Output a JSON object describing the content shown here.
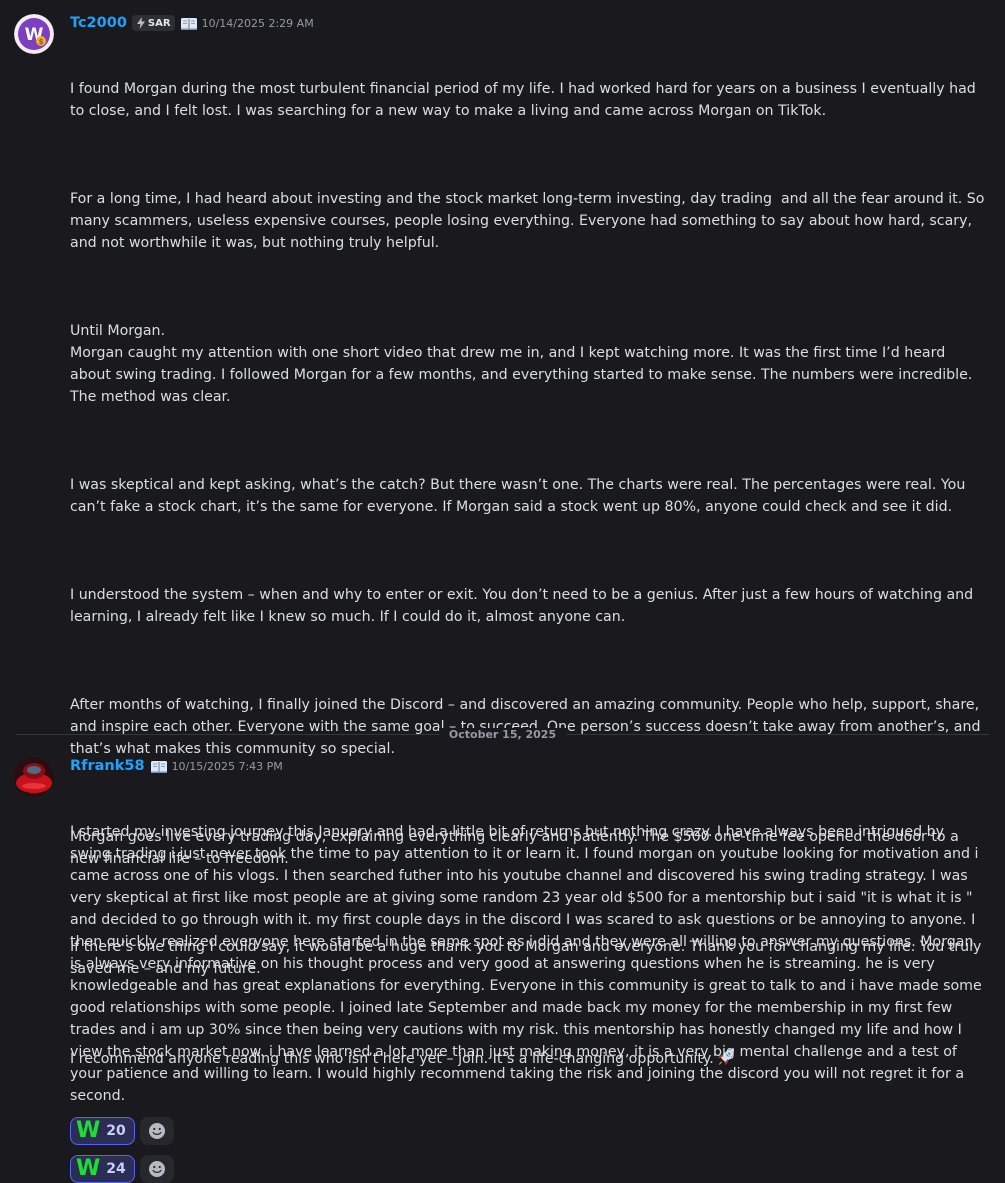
{
  "messages": [
    {
      "username": "Tc2000",
      "tag": "SAR",
      "tag_icon": "lightning-icon",
      "badge_icon": "book-icon",
      "timestamp": "10/14/2025 2:29 AM",
      "paragraphs": [
        "I found Morgan during the most turbulent financial period of my life. I had worked hard for years on a business I eventually had to close, and I felt lost. I was searching for a new way to make a living and came across Morgan on TikTok.",
        "For a long time, I had heard about investing and the stock market long-term investing, day trading  and all the fear around it. So many scammers, useless expensive courses, people losing everything. Everyone had something to say about how hard, scary, and not worthwhile it was, but nothing truly helpful.",
        "Until Morgan.\nMorgan caught my attention with one short video that drew me in, and I kept watching more. It was the first time I’d heard about swing trading. I followed Morgan for a few months, and everything started to make sense. The numbers were incredible. The method was clear.",
        "I was skeptical and kept asking, what’s the catch? But there wasn’t one. The charts were real. The percentages were real. You can’t fake a stock chart, it’s the same for everyone. If Morgan said a stock went up 80%, anyone could check and see it did.",
        "I understood the system – when and why to enter or exit. You don’t need to be a genius. After just a few hours of watching and learning, I already felt like I knew so much. If I could do it, almost anyone can.",
        "After months of watching, I finally joined the Discord – and discovered an amazing community. People who help, support, share, and inspire each other. Everyone with the same goal – to succeed. One person’s success doesn’t take away from another’s, and that’s what makes this community so special.",
        "Morgan goes live every trading day, explaining everything clearly and patiently. The $500 one-time fee opened the door to a new financial life – to freedom.",
        "If there’s one thing I could say, it would be a huge thank you to Morgan and everyone. Thank you for changing my life. You truly saved me – and my future.",
        "I recommend anyone reading this who isn’t here yet – join. It’s a life-changing opportunity."
      ],
      "trailing_emoji": "rocket-icon",
      "reaction": {
        "emoji": "W",
        "count": "20"
      }
    },
    {
      "username": "Rfrank58",
      "badge_icon": "book-icon",
      "timestamp": "10/15/2025 7:43 PM",
      "paragraphs": [
        "I started my investing journey this January and had a little bit of returns but nothing crazy. I have always been intrigued by swing trading i just never took the time to pay attention to it or learn it. I found morgan on youtube looking for motivation and i came across one of his vlogs. I then searched futher into his youtube channel and discovered his swing trading strategy. I was very skeptical at first like most people are at giving some random 23 year old $500 for a mentorship but i said \"it is what it is \" and decided to go through with it. my first couple days in the discord I was scared to ask questions or be annoying to anyone. I then quickly realized everyone here started in the same spot as i did and they were all willing to answer my questions. Morgan is always very informative on his thought process and very good at answering questions when he is streaming. he is very knowledgeable and has great explanations for everything. Everyone in this community is great to talk to and i have made some good relationships with some people. I joined late September and made back my money for the membership in my first few trades and i am up 30% since then being very cautions with my risk. this mentorship has honestly changed my life and how I view the stock market now. i have learned a lot more than just making money, it is a very big mental challenge and a test of your patience and willing to learn. I would highly recommend taking the risk and joining the discord you will not regret it for a second."
      ],
      "reaction": {
        "emoji": "W",
        "count": "24"
      }
    }
  ],
  "date_divider": "October 15, 2025",
  "colors": {
    "background": "#1a1a1e",
    "username": "#1aa3ff",
    "reaction_border": "#5865f2",
    "reaction_bg": "#2b2d52",
    "w_green": "#1fdc3a"
  }
}
